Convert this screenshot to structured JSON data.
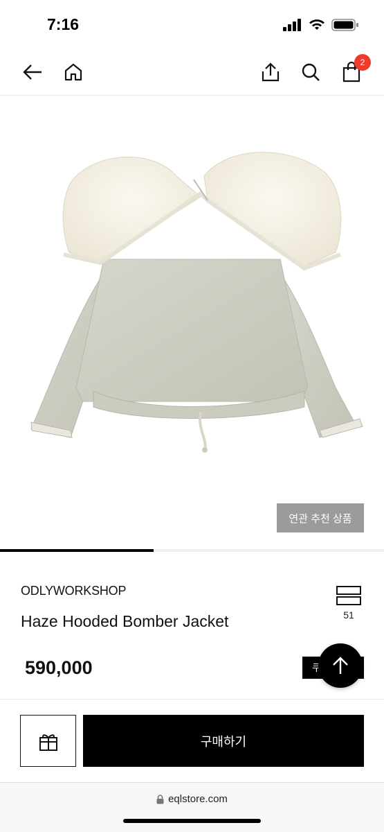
{
  "status_bar": {
    "time": "7:16"
  },
  "nav": {
    "cart_count": "2",
    "icons": [
      "back-arrow-icon",
      "home-icon",
      "share-icon",
      "search-icon",
      "shopping-bag-icon"
    ]
  },
  "product": {
    "image_subject": "jacket",
    "related_label": "연관 추천 상품",
    "brand": "ODLYWORKSHOP",
    "name": "Haze Hooded Bomber Jacket",
    "price": "590,000",
    "wish_count": "51",
    "coupon_label": "쿠",
    "image_progress": 0.4
  },
  "actions": {
    "buy_label": "구매하기",
    "gift_icon": "gift-icon"
  },
  "browser": {
    "url": "eqlstore.com"
  },
  "colors": {
    "accent": "#000000",
    "badge": "#ee3b2c",
    "related_bg": "#9b9b9b"
  }
}
